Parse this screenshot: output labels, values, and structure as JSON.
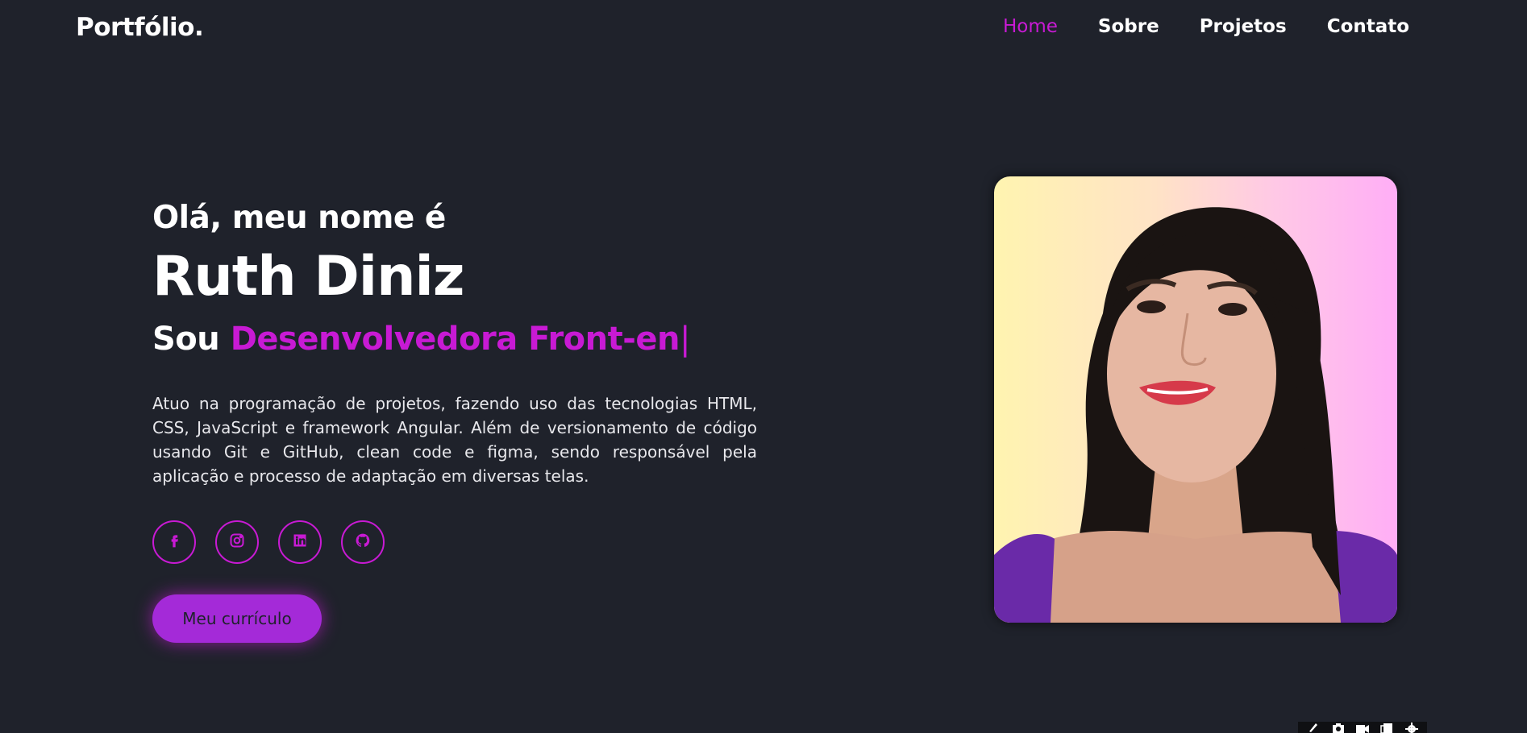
{
  "header": {
    "logo": "Portfólio.",
    "nav": [
      {
        "label": "Home",
        "active": true
      },
      {
        "label": "Sobre",
        "active": false
      },
      {
        "label": "Projetos",
        "active": false
      },
      {
        "label": "Contato",
        "active": false
      }
    ]
  },
  "hero": {
    "greeting": "Olá, meu nome é",
    "name": "Ruth Diniz",
    "role_prefix": "Sou",
    "role_typed": "Desenvolvedora Front-en",
    "role_cursor": "|",
    "description": "Atuo na programação de projetos, fazendo uso das tecnologias HTML, CSS, JavaScript e framework Angular. Além de versionamento de código usando Git e GitHub, clean code e figma, sendo responsável pela aplicação e processo de adaptação em diversas telas.",
    "socials": [
      {
        "icon": "facebook-icon"
      },
      {
        "icon": "instagram-icon"
      },
      {
        "icon": "linkedin-icon"
      },
      {
        "icon": "github-icon"
      }
    ],
    "cv_button": "Meu currículo"
  },
  "colors": {
    "background": "#1f222b",
    "accent": "#c81ad4",
    "button": "#a42ad8",
    "text": "#ffffff"
  },
  "toolbar": {
    "icons": [
      "pen-icon",
      "camera-icon",
      "video-icon",
      "copy-icon",
      "gear-icon"
    ]
  }
}
